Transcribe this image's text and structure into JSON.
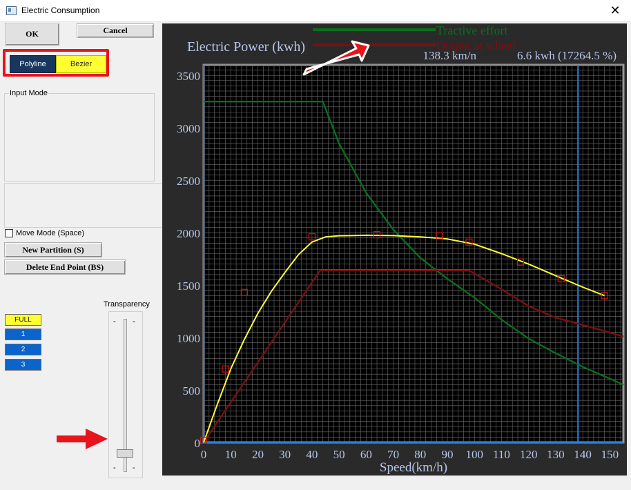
{
  "window": {
    "title": "Electric Consumption",
    "close_glyph": "✕"
  },
  "buttons": {
    "ok": "OK",
    "cancel": "Cancel",
    "new_partition": "New Partition (S)",
    "delete_end_point": "Delete End Point (BS)"
  },
  "curve_types": {
    "polyline": "Polyline",
    "bezier": "Bezier",
    "selected": "Bezier"
  },
  "input_mode": {
    "label": "Input Mode"
  },
  "move_mode": {
    "label": "Move Mode (Space)",
    "checked": false
  },
  "levels": [
    "FULL",
    "1",
    "2",
    "3"
  ],
  "transparency": {
    "label": "Transparency",
    "tick_mark": "-",
    "level": 0.12
  },
  "chart_header": {
    "title": "Electric Power (kwh)",
    "speed_readout": "138.3 km/n",
    "energy_readout": "6.6 kwh (17264.5 %)"
  },
  "colors": {
    "tractive": "#0b6e1d",
    "output": "#7a1010",
    "bezier": "#ffff33",
    "control_points": "#e01010",
    "cursor": "#2f7fd6",
    "annotation": "#e8141c"
  },
  "chart_data": {
    "type": "line",
    "xlabel": "Speed(km/h)",
    "xlim": [
      0,
      155
    ],
    "ylim": [
      0,
      3600
    ],
    "x_ticks": [
      0,
      10,
      20,
      30,
      40,
      50,
      60,
      70,
      80,
      90,
      100,
      110,
      120,
      130,
      140,
      150
    ],
    "y_ticks": [
      0,
      500,
      1000,
      1500,
      2000,
      2500,
      3000,
      3500
    ],
    "cursor_x": 138.3,
    "grid": true,
    "legend_position": "top",
    "series": [
      {
        "name": "Tractive effort",
        "role": "tractive",
        "x": [
          0,
          44,
          50,
          60,
          70,
          80,
          90,
          100,
          110,
          120,
          130,
          140,
          155
        ],
        "y": [
          3250,
          3250,
          2850,
          2380,
          2030,
          1760,
          1560,
          1380,
          1170,
          990,
          850,
          720,
          550
        ]
      },
      {
        "name": "Output at wheel",
        "role": "output",
        "x": [
          0,
          43,
          98,
          110,
          120,
          130,
          140,
          155
        ],
        "y": [
          0,
          1640,
          1640,
          1460,
          1300,
          1190,
          1120,
          1010
        ]
      },
      {
        "name": "",
        "role": "bezier",
        "x": [
          0,
          5,
          10,
          15,
          20,
          25,
          30,
          35,
          40,
          45,
          50,
          60,
          70,
          80,
          90,
          100,
          110,
          120,
          130,
          140,
          148
        ],
        "y": [
          0,
          360,
          700,
          980,
          1230,
          1440,
          1620,
          1790,
          1910,
          1960,
          1970,
          1975,
          1972,
          1960,
          1940,
          1890,
          1800,
          1700,
          1590,
          1480,
          1400
        ]
      }
    ],
    "control_points": {
      "x": [
        0,
        8,
        15,
        40,
        64,
        87,
        98,
        117,
        132,
        148
      ],
      "y": [
        20,
        700,
        1430,
        1960,
        1980,
        1970,
        1910,
        1720,
        1560,
        1400
      ]
    }
  }
}
